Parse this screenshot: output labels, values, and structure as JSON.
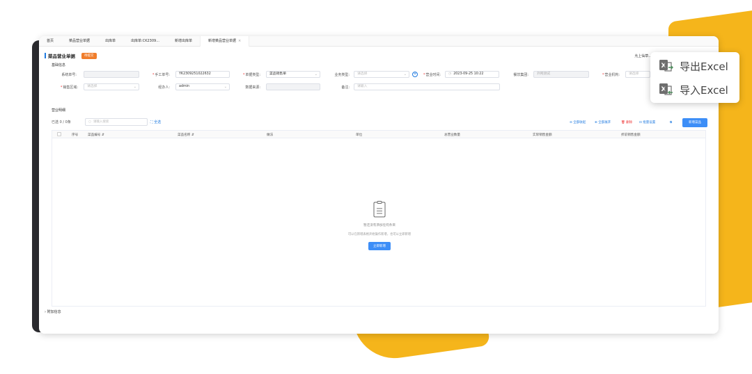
{
  "tabs": [
    {
      "label": "首页"
    },
    {
      "label": "菜品营业单据"
    },
    {
      "label": "出库单"
    },
    {
      "label": "出库单:CK2309..."
    },
    {
      "label": "新增出库单"
    },
    {
      "label": "新增菜品营业单据",
      "active": true,
      "close": "×"
    }
  ],
  "header": {
    "title": "菜品营业单据",
    "status_tag": "待提交",
    "right_text": "允上仙草..."
  },
  "sections": {
    "basic_info": "基础信息",
    "business_detail": "营业明细",
    "extra_info": "附加信息"
  },
  "form": {
    "system_no_label": "系统单号:",
    "manual_no_label": "手工单号:",
    "manual_no_value": "YK2309251022632",
    "doc_type_label": "单据类型:",
    "doc_type_value": "菜品销售单",
    "biz_type_label": "业务类型:",
    "biz_type_placeholder": "请选择",
    "biz_time_label": "营业时间:",
    "biz_time_value": "2023-09-25 10:22",
    "group_label": "餐饮集团:",
    "group_value": "外网测试",
    "org_label": "营业机构:",
    "org_placeholder": "请选择",
    "sales_area_label": "销售区域:",
    "sales_area_placeholder": "请选择",
    "handler_label": "经办人:",
    "handler_value": "admin",
    "source_label": "数据来源:",
    "remark_label": "备注:",
    "remark_placeholder": "请输入"
  },
  "toolbar": {
    "selected": "已选 0 / 0条",
    "search_placeholder": "请输入搜索",
    "all_label": "全选",
    "collapse_all": "全部收起",
    "expand_all": "全部展开",
    "delete": "删除",
    "batch_settings": "批量设置",
    "add_button": "新增菜品"
  },
  "table": {
    "columns": [
      "序号",
      "菜品编号",
      "菜品名称",
      "做法",
      "单位",
      "总营业数量",
      "实际销售金额",
      "折前销售金额"
    ]
  },
  "empty": {
    "line1": "暂还没有添加任何条目",
    "line2": "可以在新增表格开始操作新增，也可以立即新增",
    "button": "立即新增"
  },
  "excel_menu": {
    "export": "导出Excel",
    "import": "导入Excel"
  },
  "colors": {
    "accent": "#3d8ef7",
    "tag": "#f07d2b",
    "background_shape": "#f5b51b",
    "excel_green": "#4e8d5c"
  },
  "icons": [
    "clipboard-icon",
    "excel-export-icon",
    "excel-import-icon",
    "search-icon",
    "plus-circle-icon",
    "calendar-icon",
    "chevron-down-icon"
  ]
}
